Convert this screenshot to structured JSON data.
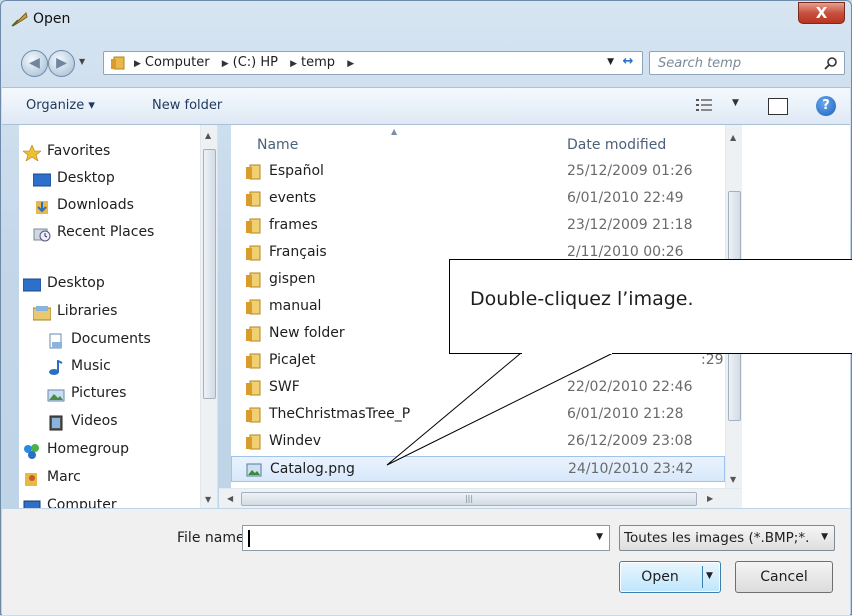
{
  "window": {
    "title": "Open",
    "close_label": "X"
  },
  "address": {
    "crumbs": [
      "Computer",
      "(C:) HP",
      "temp"
    ],
    "search_placeholder": "Search temp"
  },
  "toolbar": {
    "organize": "Organize ▾",
    "new_folder": "New folder"
  },
  "nav": [
    {
      "label": "Favorites",
      "icon": "star-icon"
    },
    {
      "label": "Desktop",
      "icon": "desktop-icon"
    },
    {
      "label": "Downloads",
      "icon": "downloads-icon"
    },
    {
      "label": "Recent Places",
      "icon": "recent-places-icon"
    },
    {
      "label": "Desktop",
      "icon": "desktop-icon"
    },
    {
      "label": "Libraries",
      "icon": "libraries-icon"
    },
    {
      "label": "Documents",
      "icon": "documents-icon"
    },
    {
      "label": "Music",
      "icon": "music-icon"
    },
    {
      "label": "Pictures",
      "icon": "pictures-icon"
    },
    {
      "label": "Videos",
      "icon": "videos-icon"
    },
    {
      "label": "Homegroup",
      "icon": "homegroup-icon"
    },
    {
      "label": "Marc",
      "icon": "user-folder-icon"
    },
    {
      "label": "Computer",
      "icon": "computer-icon"
    }
  ],
  "columns": {
    "name": "Name",
    "date": "Date modified"
  },
  "files": [
    {
      "name": "Español",
      "date": "25/12/2009 01:26",
      "type": "folder"
    },
    {
      "name": "events",
      "date": "6/01/2010 22:49",
      "type": "folder"
    },
    {
      "name": "frames",
      "date": "23/12/2009 21:18",
      "type": "folder"
    },
    {
      "name": "Français",
      "date": "2/11/2010 00:26",
      "type": "folder"
    },
    {
      "name": "gispen",
      "date": "",
      "type": "folder"
    },
    {
      "name": "manual",
      "date": "",
      "type": "folder"
    },
    {
      "name": "New folder",
      "date": "",
      "type": "folder"
    },
    {
      "name": "PicaJet",
      "date": ":29",
      "type": "folder"
    },
    {
      "name": "SWF",
      "date": "22/02/2010 22:46",
      "type": "folder"
    },
    {
      "name": "TheChristmasTree_P",
      "date": "6/01/2010 21:28",
      "type": "folder"
    },
    {
      "name": "Windev",
      "date": "26/12/2009 23:08",
      "type": "folder"
    },
    {
      "name": "Catalog.png",
      "date": "24/10/2010 23:42",
      "type": "image"
    }
  ],
  "bottom": {
    "file_name_label": "File name:",
    "file_name_value": "",
    "filter": "Toutes les images (*.BMP;*.D",
    "open": "Open",
    "cancel": "Cancel"
  },
  "callout": {
    "text": "Double-cliquez l’image."
  },
  "colors": {
    "folder": "#e8b84a",
    "accent": "#3c7fb1",
    "close": "#c75040"
  }
}
